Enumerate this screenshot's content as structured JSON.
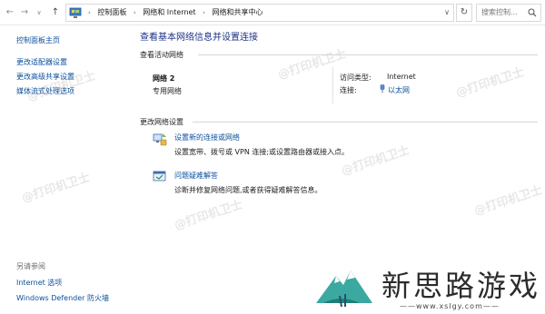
{
  "address_bar": {
    "crumbs": [
      "控制面板",
      "网络和 Internet",
      "网络和共享中心"
    ],
    "search_placeholder": "搜索控制..."
  },
  "left_panel": {
    "links": [
      "控制面板主页",
      "更改适配器设置",
      "更改高级共享设置",
      "媒体流式处理选项"
    ],
    "see_also_label": "另请参阅",
    "see_also_links": [
      "Internet 选项",
      "Windows Defender 防火墙"
    ]
  },
  "main": {
    "title": "查看基本网络信息并设置连接",
    "active_networks_header": "查看活动网络",
    "network": {
      "name": "网络 2",
      "type": "专用网络",
      "access_type_label": "访问类型:",
      "access_type_value": "Internet",
      "connections_label": "连接:",
      "connections_value": "以太网"
    },
    "change_settings_header": "更改网络设置",
    "tasks": [
      {
        "link": "设置新的连接或网络",
        "desc": "设置宽带、拨号或 VPN 连接;或设置路由器或接入点。",
        "icon": "new-connection-icon"
      },
      {
        "link": "问题疑难解答",
        "desc": "诊断并修复网络问题,或者获得疑难解答信息。",
        "icon": "troubleshoot-icon"
      }
    ]
  },
  "watermark": "@打印机卫士",
  "brand": {
    "name": "新思路游戏",
    "url": "——www.xslgy.com——"
  },
  "colors": {
    "link": "#0b4f9c",
    "title": "#1e3287"
  }
}
